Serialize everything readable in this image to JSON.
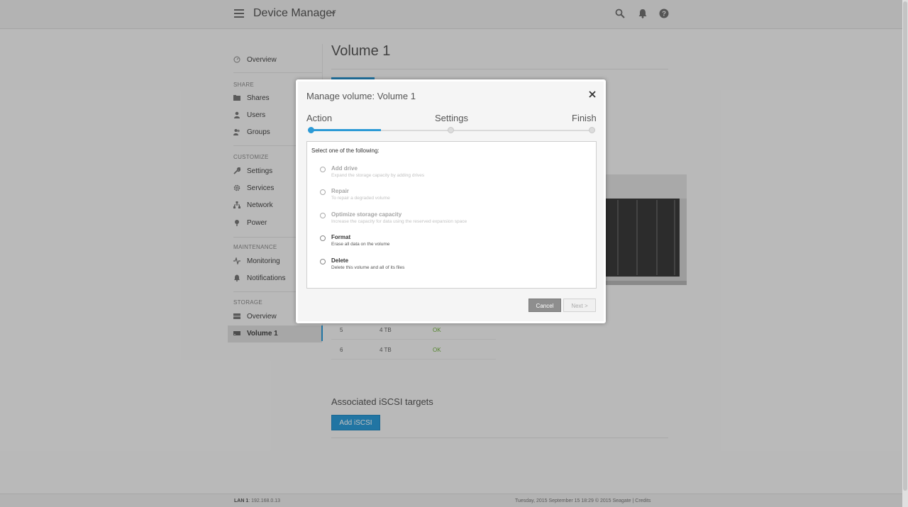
{
  "header": {
    "app_title": "Device Manager"
  },
  "sidebar": {
    "overview": "Overview",
    "share_section": "SHARE",
    "shares": "Shares",
    "users": "Users",
    "groups": "Groups",
    "customize_section": "CUSTOMIZE",
    "settings": "Settings",
    "services": "Services",
    "network": "Network",
    "power": "Power",
    "maintenance_section": "MAINTENANCE",
    "monitoring": "Monitoring",
    "notifications": "Notifications",
    "storage_section": "STORAGE",
    "storage_overview": "Overview",
    "volume1": "Volume 1"
  },
  "main": {
    "page_title": "Volume 1",
    "drives": [
      {
        "num": "5",
        "size": "4 TB",
        "status": "OK"
      },
      {
        "num": "6",
        "size": "4 TB",
        "status": "OK"
      }
    ],
    "iscsi_title": "Associated iSCSI targets",
    "iscsi_button": "Add iSCSI"
  },
  "footer": {
    "lan_label": "LAN 1",
    "lan_ip": ": 192.168.0.13",
    "right_text": "Tuesday, 2015 September 15   18:29   © 2015 Seagate | Credits"
  },
  "modal": {
    "title": "Manage volume: Volume 1",
    "steps": [
      "Action",
      "Settings",
      "Finish"
    ],
    "current_step": 1,
    "prompt": "Select one of the following:",
    "options": [
      {
        "title": "Add drive",
        "desc": "Expand the storage capacity by adding drives",
        "enabled": false
      },
      {
        "title": "Repair",
        "desc": "To repair a degraded volume",
        "enabled": false
      },
      {
        "title": "Optimize storage capacity",
        "desc": "Increase the capacity for data using the reserved expansion space",
        "enabled": false
      },
      {
        "title": "Format",
        "desc": "Erase all data on the volume",
        "enabled": true
      },
      {
        "title": "Delete",
        "desc": "Delete this volume and all of its files",
        "enabled": true
      }
    ],
    "cancel_label": "Cancel",
    "next_label": "Next >"
  },
  "colors": {
    "accent": "#2c9ad6",
    "status_ok": "#6fae3c",
    "cancel_bg": "#8e8e8e"
  }
}
